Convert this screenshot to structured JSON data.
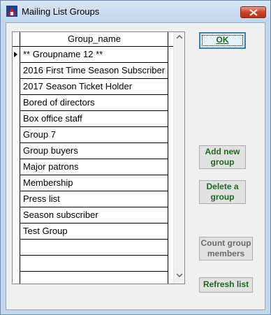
{
  "window": {
    "title": "Mailing List Groups"
  },
  "grid": {
    "column_header": "Group_name",
    "rows": [
      "** Groupname 12 **",
      "2016 First Time Season Subscriber",
      "2017 Season Ticket Holder",
      "Bored of directors",
      "Box office staff",
      "Group 7",
      "Group buyers",
      "Major patrons",
      "Membership",
      "Press list",
      "Season subscriber",
      "Test Group",
      "",
      "",
      ""
    ]
  },
  "buttons": {
    "ok": "OK",
    "add_new_group_line1": "Add new",
    "add_new_group_line2": "group",
    "delete_group_line1": "Delete a",
    "delete_group_line2": "group",
    "count_members_line1": "Count group",
    "count_members_line2": "members",
    "refresh_list": "Refresh list"
  },
  "colors": {
    "button_text_enabled": "#1e6b1e",
    "button_text_disabled": "#6d6d6d",
    "close_button": "#c7432b"
  },
  "icons": {
    "app": "theater-app-icon",
    "close": "close-icon",
    "current_row": "row-pointer-icon",
    "scroll_up": "chevron-up-icon",
    "scroll_down": "chevron-down-icon"
  }
}
